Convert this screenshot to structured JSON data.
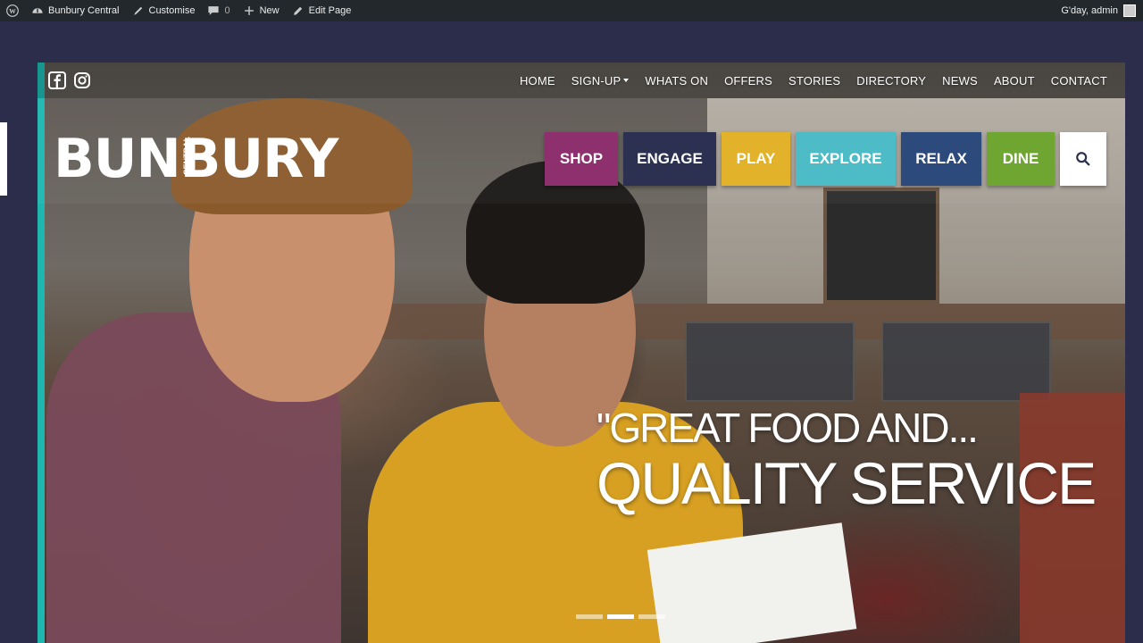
{
  "adminbar": {
    "site_name": "Bunbury Central",
    "customise": "Customise",
    "comments_count": "0",
    "new": "New",
    "edit_page": "Edit Page",
    "greeting": "G'day, admin"
  },
  "social": {
    "facebook": "facebook-icon",
    "instagram": "instagram-icon"
  },
  "nav": [
    {
      "label": "HOME"
    },
    {
      "label": "SIGN-UP",
      "dropdown": true
    },
    {
      "label": "WHATS ON"
    },
    {
      "label": "OFFERS"
    },
    {
      "label": "STORIES"
    },
    {
      "label": "DIRECTORY"
    },
    {
      "label": "NEWS"
    },
    {
      "label": "ABOUT"
    },
    {
      "label": "CONTACT"
    }
  ],
  "logo": {
    "main": "BUNBURY",
    "sub": "CENTRAL"
  },
  "categories": [
    {
      "label": "SHOP",
      "color": "#8e2f6e"
    },
    {
      "label": "ENGAGE",
      "color": "#2c3152"
    },
    {
      "label": "PLAY",
      "color": "#e2b22a"
    },
    {
      "label": "EXPLORE",
      "color": "#4dbcc6"
    },
    {
      "label": "RELAX",
      "color": "#2c4b7c"
    },
    {
      "label": "DINE",
      "color": "#6fa632"
    }
  ],
  "search_icon": "search-icon",
  "slogan": {
    "line1": "\"GREAT FOOD AND...",
    "line2": "QUALITY SERVICE"
  },
  "slider": {
    "slides": 3,
    "active": 2
  }
}
